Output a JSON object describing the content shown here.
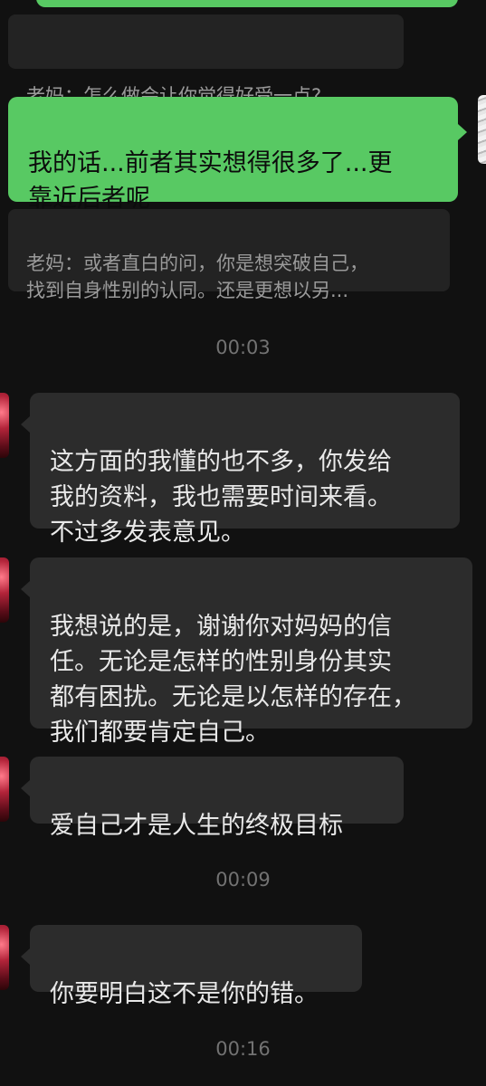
{
  "messages": {
    "quote1": "老妈：怎么做会让你觉得好受一点?",
    "sent1": "我的话...前者其实想得很多了...更\n靠近后者呢",
    "quote2": "老妈：或者直白的问，你是想突破自己，\n找到自身性别的认同。还是更想以另...",
    "time1": "00:03",
    "recv1": "这方面的我懂的也不多，你发给\n我的资料，我也需要时间来看。\n不过多发表意见。",
    "recv2": "我想说的是，谢谢你对妈妈的信\n任。无论是怎样的性别身份其实\n都有困扰。无论是以怎样的存在，\n我们都要肯定自己。",
    "recv3": "爱自己才是人生的终极目标",
    "time2": "00:09",
    "recv4": "你要明白这不是你的错。",
    "time3": "00:16"
  },
  "colors": {
    "background": "#111111",
    "sent_bubble": "#58c963",
    "received_bubble": "#2c2c2c",
    "quote_box": "#232323"
  }
}
